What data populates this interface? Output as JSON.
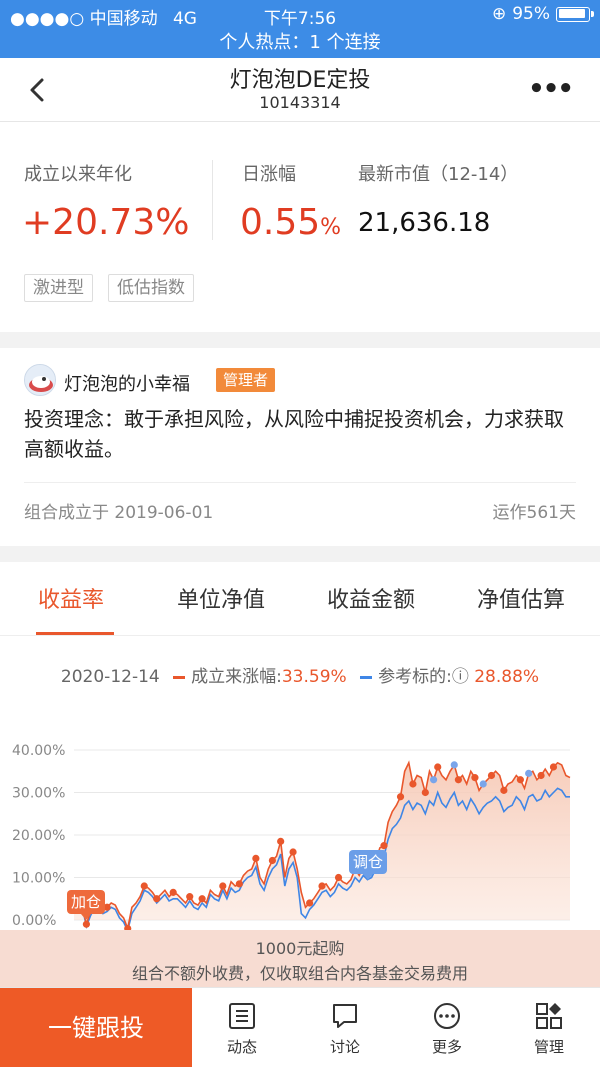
{
  "status_bar": {
    "carrier": "中国移动",
    "network": "4G",
    "time": "下午7:56",
    "battery": "95%"
  },
  "hotspot": "个人热点：1 个连接",
  "nav": {
    "title": "灯泡泡DE定投",
    "subtitle": "10143314"
  },
  "stats": {
    "annualized_label": "成立以来年化",
    "annualized_value": "+20.73%",
    "daily_label": "日涨幅",
    "daily_value": "0.55",
    "daily_unit": "%",
    "mv_label": "最新市值（12-14）",
    "mv_value": "21,636.18",
    "tags": [
      "激进型",
      "低估指数"
    ]
  },
  "manager": {
    "name": "灯泡泡的小幸福",
    "badge": "管理者",
    "philosophy": "投资理念：敢于承担风险，从风险中捕捉投资机会，力求获取高额收益。",
    "founded": "组合成立于  2019-06-01",
    "running": "运作561天"
  },
  "tabs": [
    "收益率",
    "单位净值",
    "收益金额",
    "净值估算"
  ],
  "legend": {
    "date": "2020-12-14",
    "series1_label": "成立来涨幅:",
    "series1_value": "33.59%",
    "series2_label": "参考标的:",
    "series2_value": "28.88%",
    "series1_color": "#e9572c",
    "series2_color": "#3f86e6"
  },
  "chart_data": {
    "type": "line",
    "y_ticks": [
      "40.00%",
      "30.00%",
      "20.00%",
      "10.00%",
      "0.00%"
    ],
    "ylim": [
      0,
      40
    ],
    "x": [
      0,
      1,
      2,
      3,
      4,
      5,
      6,
      7,
      8,
      9,
      10,
      11,
      12,
      13,
      14,
      15,
      16,
      17,
      18,
      19,
      20,
      21,
      22,
      23,
      24,
      25,
      26,
      27,
      28,
      29,
      30,
      31,
      32,
      33,
      34,
      35,
      36,
      37,
      38,
      39,
      40,
      41,
      42,
      43,
      44,
      45,
      46,
      47,
      48,
      49,
      50,
      51,
      52,
      53,
      54,
      55,
      56,
      57,
      58,
      59,
      60,
      61,
      62,
      63,
      64,
      65,
      66,
      67,
      68,
      69,
      70,
      71,
      72,
      73,
      74,
      75,
      76,
      77,
      78,
      79,
      80,
      81,
      82,
      83,
      84,
      85,
      86,
      87,
      88,
      89,
      90,
      91,
      92,
      93,
      94,
      95,
      96,
      97,
      98,
      99,
      100,
      101,
      102,
      103,
      104,
      105,
      106,
      107,
      108,
      109,
      110,
      111,
      112,
      113,
      114,
      115,
      116,
      117,
      118,
      119,
      120
    ],
    "series": [
      {
        "name": "成立来涨幅",
        "color": "#e9572c",
        "values": [
          4.5,
          3.0,
          3.5,
          -1.0,
          2.0,
          4.0,
          3.0,
          2.5,
          3.0,
          4.0,
          3.5,
          1.5,
          0.5,
          -2.0,
          3.0,
          4.0,
          5.5,
          8.0,
          7.5,
          6.5,
          5.0,
          6.0,
          7.0,
          5.5,
          6.5,
          6.0,
          5.0,
          4.0,
          5.5,
          4.0,
          3.5,
          5.0,
          4.0,
          7.0,
          6.0,
          5.5,
          8.0,
          6.0,
          9.0,
          8.0,
          8.5,
          10.5,
          11.5,
          12.0,
          14.5,
          10.0,
          8.5,
          12.0,
          14.0,
          15.0,
          18.5,
          10.0,
          14.5,
          16.0,
          12.0,
          6.5,
          3.0,
          4.0,
          5.0,
          6.5,
          8.0,
          8.5,
          7.0,
          8.0,
          10.0,
          9.0,
          8.5,
          9.5,
          12.0,
          10.5,
          12.5,
          11.0,
          12.0,
          14.0,
          17.0,
          17.5,
          23.0,
          25.5,
          27.0,
          29.0,
          35.0,
          37.0,
          32.0,
          34.0,
          33.5,
          30.0,
          35.0,
          33.0,
          36.0,
          34.0,
          33.0,
          35.0,
          36.5,
          33.0,
          34.0,
          32.0,
          35.0,
          33.5,
          30.5,
          32.0,
          33.0,
          34.0,
          35.0,
          34.0,
          30.5,
          32.0,
          32.5,
          34.0,
          33.0,
          31.0,
          34.5,
          35.0,
          33.0,
          34.0,
          35.5,
          34.0,
          36.0,
          37.0,
          36.5,
          34.0,
          33.5
        ]
      },
      {
        "name": "参考标的",
        "color": "#3f86e6",
        "values": [
          3.0,
          2.0,
          3.0,
          -1.5,
          1.0,
          3.0,
          2.5,
          1.5,
          2.0,
          3.0,
          2.5,
          0.5,
          -0.5,
          -2.5,
          1.5,
          3.0,
          4.5,
          7.0,
          6.5,
          5.5,
          4.0,
          5.0,
          6.0,
          4.5,
          5.0,
          5.0,
          4.0,
          3.0,
          4.5,
          3.0,
          2.5,
          4.0,
          3.0,
          6.0,
          5.0,
          4.5,
          7.0,
          5.0,
          7.5,
          6.5,
          7.0,
          9.0,
          10.0,
          10.5,
          12.5,
          8.5,
          7.0,
          10.0,
          12.0,
          13.0,
          15.5,
          8.0,
          12.0,
          13.5,
          10.0,
          1.5,
          0.5,
          2.5,
          3.5,
          5.0,
          6.5,
          7.0,
          5.5,
          6.5,
          8.5,
          7.5,
          7.0,
          8.0,
          10.0,
          9.0,
          10.5,
          9.5,
          10.0,
          12.0,
          14.5,
          15.0,
          19.0,
          21.5,
          22.5,
          24.0,
          27.0,
          28.0,
          26.0,
          27.5,
          27.0,
          25.0,
          28.0,
          27.0,
          30.0,
          27.5,
          26.5,
          28.5,
          30.0,
          27.0,
          28.0,
          26.0,
          28.5,
          27.0,
          25.0,
          26.5,
          27.5,
          28.0,
          29.0,
          28.0,
          25.5,
          26.5,
          27.0,
          29.0,
          28.0,
          26.0,
          29.0,
          29.5,
          28.0,
          28.5,
          30.5,
          29.0,
          30.0,
          31.0,
          30.5,
          29.0,
          29.0
        ]
      }
    ],
    "annotations": [
      "加仓",
      "调仓"
    ]
  },
  "banner": {
    "line1": "1000元起购",
    "line2": "组合不额外收费，仅收取组合内各基金交易费用"
  },
  "bottom": {
    "follow": "一键跟投",
    "items": [
      "动态",
      "讨论",
      "更多",
      "管理"
    ]
  }
}
